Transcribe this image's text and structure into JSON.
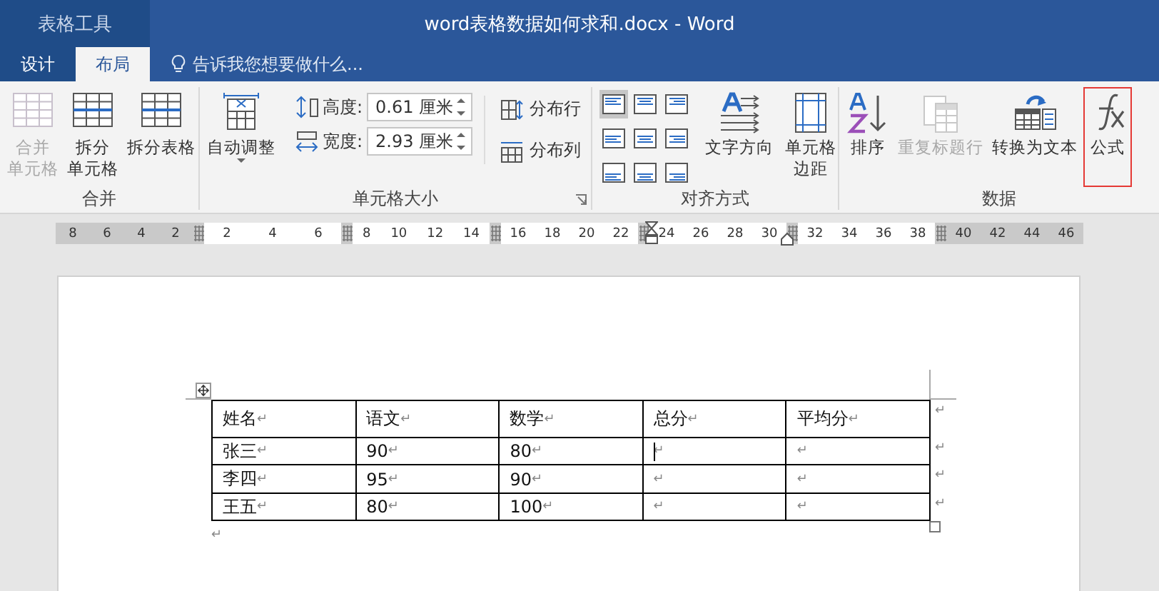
{
  "context_tab": {
    "label": "表格工具"
  },
  "window": {
    "title": "word表格数据如何求和.docx - Word"
  },
  "tabs": [
    {
      "label": "设计",
      "selected": false
    },
    {
      "label": "布局",
      "selected": true
    }
  ],
  "tell_me": {
    "placeholder": "告诉我您想要做什么..."
  },
  "ribbon": {
    "groups": [
      {
        "label": "合并",
        "items": [
          {
            "kind": "button",
            "label_lines": [
              "合并",
              "单元格"
            ],
            "disabled": true,
            "highlighted": false,
            "dropdown": false
          },
          {
            "kind": "button",
            "label_lines": [
              "拆分",
              "单元格"
            ],
            "disabled": false,
            "highlighted": false,
            "dropdown": false
          },
          {
            "kind": "button",
            "label_lines": [
              "拆分表格"
            ],
            "disabled": false,
            "highlighted": false,
            "dropdown": false
          }
        ]
      },
      {
        "label": "单元格大小",
        "launcher": true,
        "items": [
          {
            "kind": "button",
            "label_lines": [
              "自动调整"
            ],
            "disabled": false,
            "highlighted": false,
            "dropdown": true
          },
          {
            "kind": "size-fields",
            "fields": [
              {
                "label": "高度:",
                "value": "0.61 厘米"
              },
              {
                "label": "宽度:",
                "value": "2.93 厘米"
              }
            ]
          },
          {
            "kind": "small-buttons",
            "buttons": [
              {
                "label": "分布行"
              },
              {
                "label": "分布列"
              }
            ]
          }
        ]
      },
      {
        "label": "对齐方式",
        "items": [
          {
            "kind": "align-grid",
            "cells": [
              {
                "selected": true
              },
              {
                "selected": false
              },
              {
                "selected": false
              },
              {
                "selected": false
              },
              {
                "selected": false
              },
              {
                "selected": false
              },
              {
                "selected": false
              },
              {
                "selected": false
              },
              {
                "selected": false
              }
            ]
          },
          {
            "kind": "button",
            "label_lines": [
              "文字方向"
            ],
            "disabled": false,
            "highlighted": false,
            "dropdown": false
          },
          {
            "kind": "button",
            "label_lines": [
              "单元格",
              "边距"
            ],
            "disabled": false,
            "highlighted": false,
            "dropdown": false
          }
        ]
      },
      {
        "label": "数据",
        "items": [
          {
            "kind": "button",
            "label_lines": [
              "排序"
            ],
            "disabled": false,
            "highlighted": false,
            "dropdown": false
          },
          {
            "kind": "button",
            "label_lines": [
              "重复标题行"
            ],
            "disabled": true,
            "highlighted": false,
            "dropdown": false
          },
          {
            "kind": "button",
            "label_lines": [
              "转换为文本"
            ],
            "disabled": false,
            "highlighted": false,
            "dropdown": false
          },
          {
            "kind": "button",
            "label_lines": [
              "公式"
            ],
            "disabled": false,
            "highlighted": true,
            "dropdown": false
          }
        ]
      }
    ]
  },
  "ruler": {
    "segments": [
      {
        "shaded": true,
        "ticks": [
          "8",
          "6",
          "4",
          "2"
        ]
      },
      {
        "shaded": false,
        "ticks": [
          "2",
          "4",
          "6"
        ]
      },
      {
        "shaded": false,
        "ticks": [
          "8",
          "10",
          "12",
          "14"
        ]
      },
      {
        "shaded": false,
        "ticks": [
          "16",
          "18",
          "20",
          "22"
        ]
      },
      {
        "shaded": false,
        "ticks": [
          "24",
          "26",
          "28",
          "30"
        ]
      },
      {
        "shaded": false,
        "ticks": [
          "32",
          "34",
          "36",
          "38"
        ]
      },
      {
        "shaded": true,
        "ticks": [
          "40",
          "42",
          "44",
          "46"
        ]
      }
    ]
  },
  "table": {
    "rows": [
      {
        "end_mark": "↵",
        "cells": [
          {
            "text": "姓名",
            "mark": "↵",
            "focused": false
          },
          {
            "text": "语文",
            "mark": "↵",
            "focused": false
          },
          {
            "text": "数学",
            "mark": "↵",
            "focused": false
          },
          {
            "text": "总分",
            "mark": "↵",
            "focused": false
          },
          {
            "text": "平均分",
            "mark": "↵",
            "focused": false
          }
        ]
      },
      {
        "end_mark": "↵",
        "cells": [
          {
            "text": "张三",
            "mark": "↵",
            "focused": false
          },
          {
            "text": "90",
            "mark": "↵",
            "focused": false
          },
          {
            "text": "80",
            "mark": "↵",
            "focused": false
          },
          {
            "mark": "↵",
            "focused": true
          },
          {
            "mark": "↵",
            "focused": false
          }
        ]
      },
      {
        "end_mark": "↵",
        "cells": [
          {
            "text": "李四",
            "mark": "↵",
            "focused": false
          },
          {
            "text": "95",
            "mark": "↵",
            "focused": false
          },
          {
            "text": "90",
            "mark": "↵",
            "focused": false
          },
          {
            "mark": "↵",
            "focused": false
          },
          {
            "mark": "↵",
            "focused": false
          }
        ]
      },
      {
        "end_mark": "↵",
        "cells": [
          {
            "text": "王五",
            "mark": "↵",
            "focused": false
          },
          {
            "text": "80",
            "mark": "↵",
            "focused": false
          },
          {
            "text": "100",
            "mark": "↵",
            "focused": false
          },
          {
            "mark": "↵",
            "focused": false
          },
          {
            "mark": "↵",
            "focused": false
          }
        ]
      }
    ]
  },
  "after_table": {
    "mark": "↵"
  }
}
